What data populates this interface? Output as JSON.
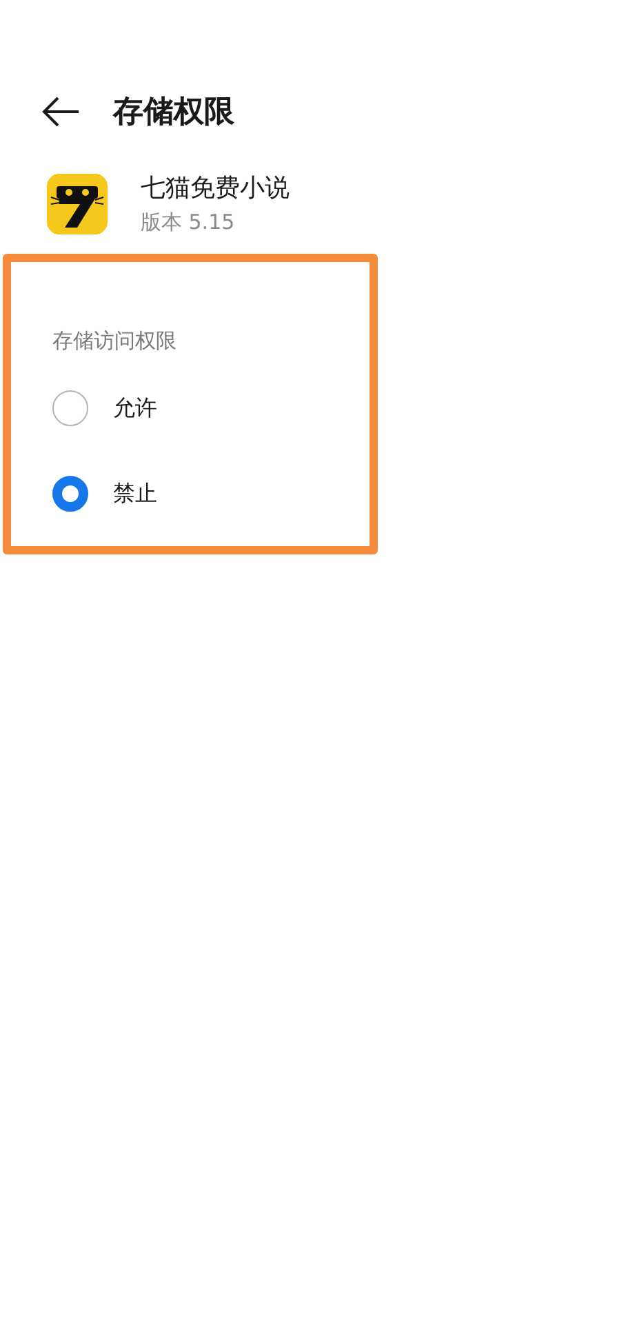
{
  "header": {
    "title": "存储权限"
  },
  "app": {
    "name": "七猫免费小说",
    "version": "版本 5.15"
  },
  "section": {
    "title": "存储访问权限",
    "highlighted": true,
    "options": [
      {
        "label": "允许",
        "selected": false
      },
      {
        "label": "禁止",
        "selected": true
      }
    ]
  }
}
